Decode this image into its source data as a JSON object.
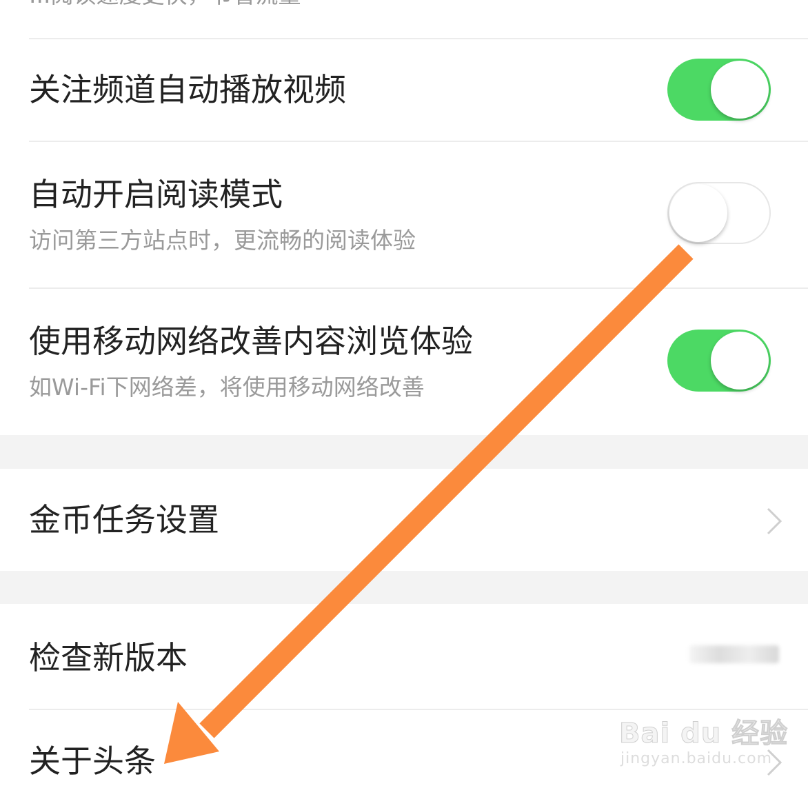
{
  "top_cut_text": "...阅读速度更快，节省流量",
  "settings": {
    "follow_autoplay": {
      "title": "关注频道自动播放视频",
      "enabled": true
    },
    "reader_mode": {
      "title": "自动开启阅读模式",
      "subtitle": "访问第三方站点时，更流畅的阅读体验",
      "enabled": false
    },
    "mobile_network": {
      "title": "使用移动网络改善内容浏览体验",
      "subtitle": "如Wi-Fi下网络差，将使用移动网络改善",
      "enabled": true
    },
    "coin_tasks": {
      "title": "金币任务设置"
    },
    "check_version": {
      "title": "检查新版本"
    },
    "about": {
      "title": "关于头条"
    }
  },
  "watermark": {
    "main": "Bai du 经验",
    "sub": "jingyan.baidu.com"
  },
  "colors": {
    "toggle_on": "#4cd964",
    "arrow": "#fb8a3c",
    "section_gap": "#f3f3f3"
  },
  "icons": {
    "chevron": "chevron-right-icon",
    "arrow": "orange-annotation-arrow"
  }
}
